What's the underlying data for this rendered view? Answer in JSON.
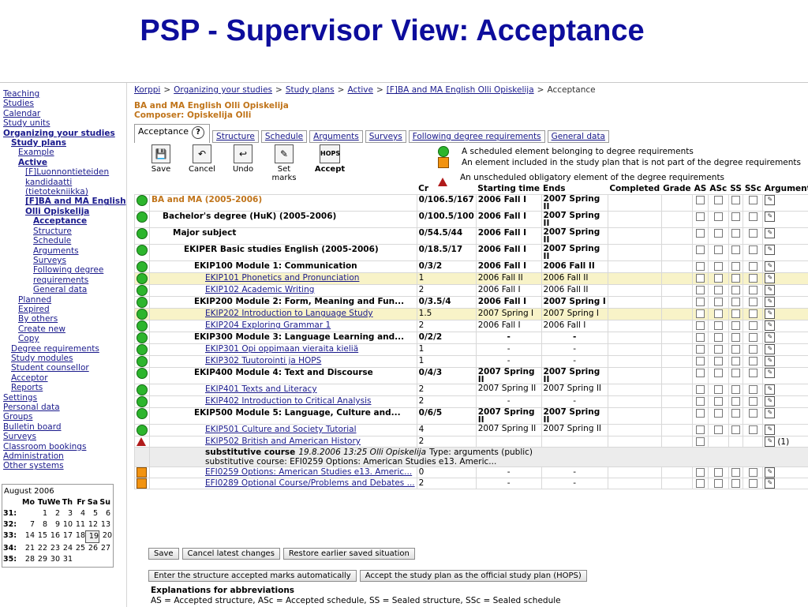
{
  "slide_title": "PSP - Supervisor View: Acceptance",
  "nav": [
    {
      "label": "Teaching",
      "indent": 0,
      "bold": false
    },
    {
      "label": "Studies",
      "indent": 0,
      "bold": false
    },
    {
      "label": "Calendar",
      "indent": 0,
      "bold": false
    },
    {
      "label": "Study units",
      "indent": 0,
      "bold": false
    },
    {
      "label": "Organizing your studies",
      "indent": 0,
      "bold": true
    },
    {
      "label": "Study plans",
      "indent": 1,
      "bold": true
    },
    {
      "label": "Example",
      "indent": 2,
      "bold": false
    },
    {
      "label": "Active",
      "indent": 2,
      "bold": true
    },
    {
      "label": "[F]Luonnontieteiden",
      "indent": 3,
      "bold": false
    },
    {
      "label": "kandidaatti",
      "indent": 3,
      "bold": false
    },
    {
      "label": "(tietotekniikka)",
      "indent": 3,
      "bold": false
    },
    {
      "label": "[F]BA and MA English",
      "indent": 3,
      "bold": true
    },
    {
      "label": "Olli Opiskelija",
      "indent": 3,
      "bold": true
    },
    {
      "label": "Acceptance",
      "indent": 4,
      "bold": true
    },
    {
      "label": "Structure",
      "indent": 4,
      "bold": false
    },
    {
      "label": "Schedule",
      "indent": 4,
      "bold": false
    },
    {
      "label": "Arguments",
      "indent": 4,
      "bold": false
    },
    {
      "label": "Surveys",
      "indent": 4,
      "bold": false
    },
    {
      "label": "Following degree",
      "indent": 4,
      "bold": false
    },
    {
      "label": "requirements",
      "indent": 4,
      "bold": false
    },
    {
      "label": "General data",
      "indent": 4,
      "bold": false
    },
    {
      "label": "Planned",
      "indent": 2,
      "bold": false
    },
    {
      "label": "Expired",
      "indent": 2,
      "bold": false
    },
    {
      "label": "By others",
      "indent": 2,
      "bold": false
    },
    {
      "label": "Create new",
      "indent": 2,
      "bold": false
    },
    {
      "label": "Copy",
      "indent": 2,
      "bold": false
    },
    {
      "label": "Degree requirements",
      "indent": 1,
      "bold": false
    },
    {
      "label": "Study modules",
      "indent": 1,
      "bold": false
    },
    {
      "label": "Student counsellor",
      "indent": 1,
      "bold": false
    },
    {
      "label": "Acceptor",
      "indent": 1,
      "bold": false
    },
    {
      "label": "Reports",
      "indent": 1,
      "bold": false
    },
    {
      "label": "Settings",
      "indent": 0,
      "bold": false
    },
    {
      "label": "Personal data",
      "indent": 0,
      "bold": false
    },
    {
      "label": "Groups",
      "indent": 0,
      "bold": false
    },
    {
      "label": "Bulletin board",
      "indent": 0,
      "bold": false
    },
    {
      "label": "Surveys",
      "indent": 0,
      "bold": false
    },
    {
      "label": "Classroom bookings",
      "indent": 0,
      "bold": false
    },
    {
      "label": "Administration",
      "indent": 0,
      "bold": false
    },
    {
      "label": "Other systems",
      "indent": 0,
      "bold": false
    }
  ],
  "calendar": {
    "month": "August 2006",
    "header": [
      "Mo",
      "Tu",
      "We",
      "Th",
      "Fr",
      "Sa",
      "Su"
    ],
    "weeks": [
      {
        "wk": "31:",
        "days": [
          "",
          "1",
          "2",
          "3",
          "4",
          "5",
          "6"
        ]
      },
      {
        "wk": "32:",
        "days": [
          "7",
          "8",
          "9",
          "10",
          "11",
          "12",
          "13"
        ]
      },
      {
        "wk": "33:",
        "days": [
          "14",
          "15",
          "16",
          "17",
          "18",
          "19",
          "20"
        ]
      },
      {
        "wk": "34:",
        "days": [
          "21",
          "22",
          "23",
          "24",
          "25",
          "26",
          "27"
        ]
      },
      {
        "wk": "35:",
        "days": [
          "28",
          "29",
          "30",
          "31",
          "",
          "",
          ""
        ]
      }
    ],
    "today": "19"
  },
  "breadcrumb": {
    "items": [
      "Korppi",
      "Organizing your studies",
      "Study plans",
      "Active",
      "[F]BA and MA English Olli Opiskelija"
    ],
    "separator": ">",
    "current": "Acceptance"
  },
  "plan": {
    "title": "BA and MA English Olli Opiskelija",
    "composer": "Composer: Opiskelija Olli"
  },
  "tabs": [
    {
      "label": "Acceptance",
      "active": true
    },
    {
      "label": "Structure",
      "active": false
    },
    {
      "label": "Schedule",
      "active": false
    },
    {
      "label": "Arguments",
      "active": false
    },
    {
      "label": "Surveys",
      "active": false
    },
    {
      "label": "Following degree requirements",
      "active": false
    },
    {
      "label": "General data",
      "active": false
    }
  ],
  "help_icon": "?",
  "toolbar": {
    "save": "Save",
    "cancel": "Cancel",
    "undo": "Undo",
    "set_marks_1": "Set",
    "set_marks_2": "marks",
    "hops_icon": "HOPS",
    "accept": "Accept"
  },
  "legend": [
    {
      "marker": "green-circle",
      "text": "A scheduled element belonging to degree requirements"
    },
    {
      "marker": "orange-square",
      "text": "An element included in the study plan that is not part of the degree requirements"
    },
    {
      "marker": "red-triangle",
      "text": "An unscheduled obligatory element of the degree requirements"
    }
  ],
  "columns": [
    "Cr",
    "Starting time",
    "Ends",
    "Completed",
    "Grade",
    "AS",
    "ASc",
    "SS",
    "SSc",
    "Arguments"
  ],
  "rows": [
    {
      "marker": "green",
      "level": 0,
      "name": "BA and MA (2005-2006)",
      "style": "orange-bold",
      "cr": "0/106.5/167",
      "start": "2006 Fall I",
      "ends": "2007 Spring II",
      "hl": false,
      "checks": 4
    },
    {
      "marker": "green",
      "level": 1,
      "name": "Bachelor's degree (HuK) (2005-2006)",
      "style": "bold",
      "cr": "0/100.5/100",
      "start": "2006 Fall I",
      "ends": "2007 Spring II",
      "hl": false,
      "checks": 4
    },
    {
      "marker": "green",
      "level": 2,
      "name": "Major subject",
      "style": "bold",
      "cr": "0/54.5/44",
      "start": "2006 Fall I",
      "ends": "2007 Spring II",
      "hl": false,
      "checks": 4
    },
    {
      "marker": "green",
      "level": 3,
      "name": "EKIPER Basic studies English (2005-2006)",
      "style": "bold",
      "cr": "0/18.5/17",
      "start": "2006 Fall I",
      "ends": "2007 Spring II",
      "hl": false,
      "checks": 4
    },
    {
      "marker": "green",
      "level": 4,
      "name": "EKIP100 Module 1: Communication",
      "style": "bold",
      "cr": "0/3/2",
      "start": "2006 Fall I",
      "ends": "2006 Fall II",
      "hl": false,
      "checks": 4
    },
    {
      "marker": "green",
      "level": 5,
      "name": "EKIP101 Phonetics and Pronunciation",
      "style": "link",
      "cr": "1",
      "start": "2006 Fall II",
      "ends": "2006 Fall II",
      "hl": true,
      "checks": 4
    },
    {
      "marker": "green",
      "level": 5,
      "name": "EKIP102 Academic Writing",
      "style": "link",
      "cr": "2",
      "start": "2006 Fall I",
      "ends": "2006 Fall II",
      "hl": false,
      "checks": 4
    },
    {
      "marker": "green",
      "level": 4,
      "name": "EKIP200 Module 2: Form, Meaning and Fun...",
      "style": "bold",
      "cr": "0/3.5/4",
      "start": "2006 Fall I",
      "ends": "2007 Spring I",
      "hl": false,
      "checks": 4
    },
    {
      "marker": "green",
      "level": 5,
      "name": "EKIP202 Introduction to Language Study",
      "style": "link",
      "cr": "1.5",
      "start": "2007 Spring I",
      "ends": "2007 Spring I",
      "hl": true,
      "checks": 4
    },
    {
      "marker": "green",
      "level": 5,
      "name": "EKIP204 Exploring Grammar 1",
      "style": "link",
      "cr": "2",
      "start": "2006 Fall I",
      "ends": "2006 Fall I",
      "hl": false,
      "checks": 4
    },
    {
      "marker": "green",
      "level": 4,
      "name": "EKIP300 Module 3: Language Learning and...",
      "style": "bold",
      "cr": "0/2/2",
      "start": "-",
      "ends": "-",
      "hl": false,
      "checks": 4
    },
    {
      "marker": "green",
      "level": 5,
      "name": "EKIP301 Opi oppimaan vieraita kieliä",
      "style": "link",
      "cr": "1",
      "start": "-",
      "ends": "-",
      "hl": false,
      "checks": 4
    },
    {
      "marker": "green",
      "level": 5,
      "name": "EKIP302 Tuutorointi ja HOPS",
      "style": "link",
      "cr": "1",
      "start": "-",
      "ends": "-",
      "hl": false,
      "checks": 4
    },
    {
      "marker": "green",
      "level": 4,
      "name": "EKIP400 Module 4: Text and Discourse",
      "style": "bold",
      "cr": "0/4/3",
      "start": "2007 Spring II",
      "ends": "2007 Spring II",
      "hl": false,
      "checks": 4
    },
    {
      "marker": "green",
      "level": 5,
      "name": "EKIP401 Texts and Literacy",
      "style": "link",
      "cr": "2",
      "start": "2007 Spring II",
      "ends": "2007 Spring II",
      "hl": false,
      "checks": 4
    },
    {
      "marker": "green",
      "level": 5,
      "name": "EKIP402 Introduction to Critical Analysis",
      "style": "link",
      "cr": "2",
      "start": "-",
      "ends": "-",
      "hl": false,
      "checks": 4
    },
    {
      "marker": "green",
      "level": 4,
      "name": "EKIP500 Module 5: Language, Culture and...",
      "style": "bold",
      "cr": "0/6/5",
      "start": "2007 Spring II",
      "ends": "2007 Spring II",
      "hl": false,
      "checks": 4
    },
    {
      "marker": "green",
      "level": 5,
      "name": "EKIP501 Culture and Society Tutorial",
      "style": "link",
      "cr": "4",
      "start": "2007 Spring II",
      "ends": "2007 Spring II",
      "hl": false,
      "checks": 4
    },
    {
      "marker": "red",
      "level": 5,
      "name": "EKIP502 British and American History",
      "style": "link",
      "cr": "2",
      "start": "",
      "ends": "",
      "hl": false,
      "checks": 1,
      "argument_note": "(1)"
    },
    {
      "marker": "orange",
      "level": 5,
      "name": "EFI0259 Options: American Studies e13. Americ...",
      "style": "link",
      "cr": "0",
      "start": "-",
      "ends": "-",
      "hl": false,
      "checks": 4
    },
    {
      "marker": "orange",
      "level": 5,
      "name": "EFI0289 Optional Course/Problems and Debates ...",
      "style": "link",
      "cr": "2",
      "start": "-",
      "ends": "-",
      "hl": false,
      "checks": 4
    }
  ],
  "substitutive": {
    "label": "substitutive course",
    "meta": "19.8.2006 13:25 Olli Opiskelija",
    "type": "Type: arguments (public)",
    "line2": "substitutive course: EFI0259 Options: American Studies e13. Americ..."
  },
  "buttons_row1": [
    "Save",
    "Cancel latest changes",
    "Restore earlier saved situation"
  ],
  "buttons_row2": [
    "Enter the structure accepted marks automatically",
    "Accept the study plan as the official study plan (HOPS)"
  ],
  "explanations": {
    "title": "Explanations for abbreviations",
    "text": "AS = Accepted structure, ASc = Accepted schedule, SS = Sealed structure, SSc = Sealed schedule"
  },
  "colors": {
    "title_blue": "#0d0d9c",
    "link_blue": "#1a1a8c",
    "orange_text": "#c0741a",
    "highlight_row": "#f8f3c8",
    "green_marker": "#2db52d",
    "orange_marker": "#f29310",
    "red_marker": "#b01a1a"
  }
}
